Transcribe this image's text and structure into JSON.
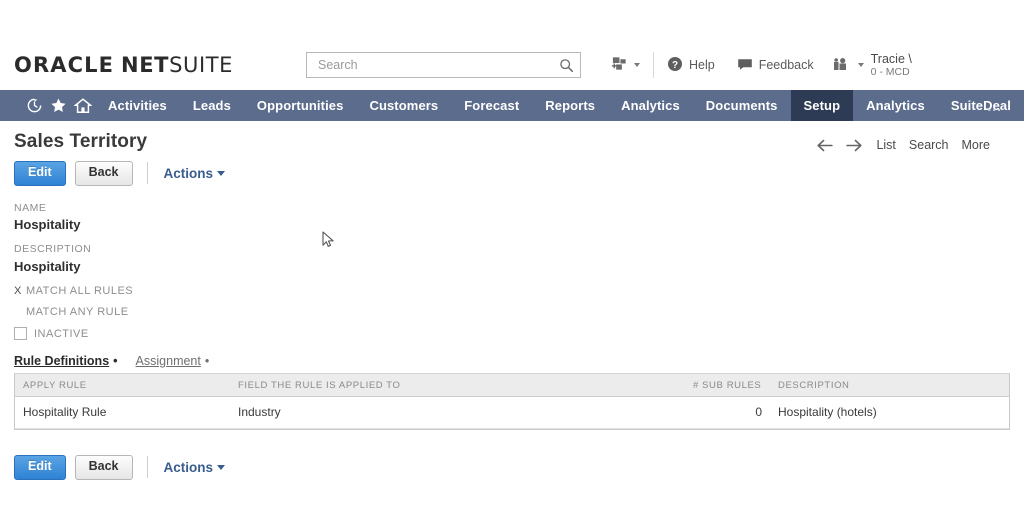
{
  "header": {
    "logo_oracle": "ORACLE",
    "logo_net": "NET",
    "logo_suite": "SUITE",
    "search_placeholder": "Search",
    "search_value": "",
    "quick_add_label": "",
    "help_label": "Help",
    "feedback_label": "Feedback",
    "user_name": "Tracie \\",
    "user_role": "0 - MCD"
  },
  "nav": {
    "icons": [
      "history-icon",
      "star-icon",
      "home-icon"
    ],
    "items": [
      {
        "label": "Activities",
        "active": false
      },
      {
        "label": "Leads",
        "active": false
      },
      {
        "label": "Opportunities",
        "active": false
      },
      {
        "label": "Customers",
        "active": false
      },
      {
        "label": "Forecast",
        "active": false
      },
      {
        "label": "Reports",
        "active": false
      },
      {
        "label": "Analytics",
        "active": false
      },
      {
        "label": "Documents",
        "active": false
      },
      {
        "label": "Setup",
        "active": true
      },
      {
        "label": "Analytics",
        "active": false
      },
      {
        "label": "SuiteDeal",
        "active": false
      }
    ],
    "more": "...",
    "bar_color": "#5c6c8d",
    "active_color": "#2d3b55"
  },
  "page": {
    "title": "Sales Territory",
    "links": [
      "List",
      "Search",
      "More"
    ]
  },
  "toolbar_top": {
    "edit_label": "Edit",
    "back_label": "Back",
    "actions_label": "Actions"
  },
  "toolbar_bottom": {
    "edit_label": "Edit",
    "back_label": "Back",
    "actions_label": "Actions"
  },
  "fields": {
    "name_label": "NAME",
    "name_value": "Hospitality",
    "description_label": "DESCRIPTION",
    "description_value": "Hospitality",
    "match_all_mark": "X",
    "match_all_label": "MATCH ALL RULES",
    "match_any_mark": "",
    "match_any_label": "MATCH ANY RULE",
    "inactive_label": "INACTIVE",
    "inactive_checked": false
  },
  "sublist": {
    "tabs": [
      {
        "label": "Rule Definitions",
        "dot": "•",
        "active": true
      },
      {
        "label": "Assignment",
        "dot": "•",
        "active": false
      }
    ],
    "columns": [
      "APPLY RULE",
      "FIELD THE RULE IS APPLIED TO",
      "# SUB RULES",
      "DESCRIPTION"
    ],
    "rows": [
      {
        "apply_rule": "Hospitality Rule",
        "field_applied_to": "Industry",
        "sub_rules": "0",
        "description": "Hospitality (hotels)"
      }
    ]
  },
  "colors": {
    "primary_button": "#2f82d4",
    "link": "#3a5d8f",
    "nav_bar": "#5c6c8d"
  }
}
